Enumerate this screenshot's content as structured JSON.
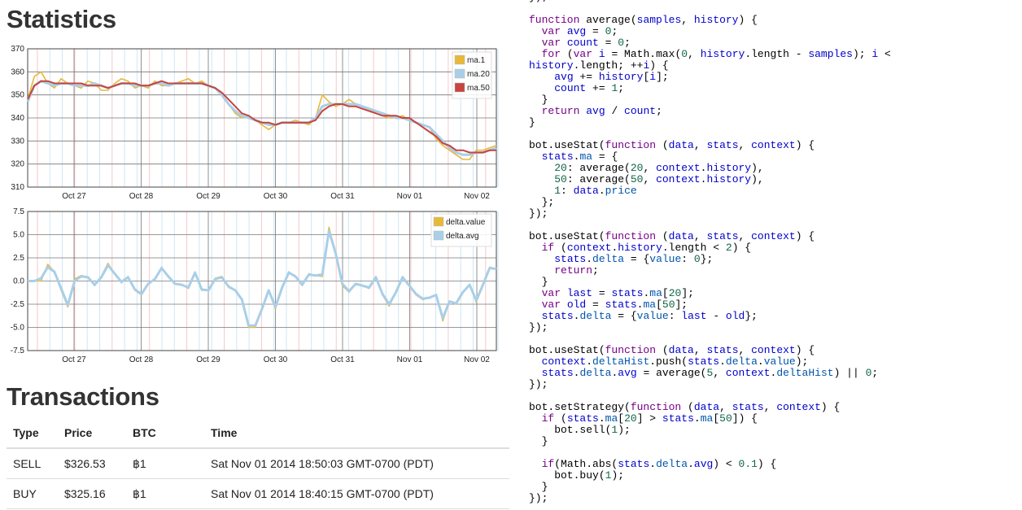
{
  "statistics_title": "Statistics",
  "transactions_title": "Transactions",
  "chart_data": [
    {
      "type": "line",
      "ylim": [
        310,
        370
      ],
      "yticks": [
        "370",
        "360",
        "350",
        "340",
        "330",
        "320",
        "310"
      ],
      "xticks": [
        "Oct 27",
        "Oct 28",
        "Oct 29",
        "Oct 30",
        "Oct 31",
        "Nov 01",
        "Nov 02"
      ],
      "legend": "top-right",
      "grid": true,
      "colors": {
        "ma.1": "#e8b83a",
        "ma.20": "#a9cfe8",
        "ma.50": "#c8443e"
      },
      "series": [
        {
          "name": "ma.1",
          "values": [
            348,
            358,
            360,
            355,
            353,
            357,
            355,
            354,
            353,
            356,
            355,
            352,
            352,
            355,
            357,
            356,
            353,
            354,
            353,
            356,
            354,
            354,
            355,
            356,
            357,
            355,
            356,
            354,
            353,
            350,
            346,
            342,
            340,
            341,
            339,
            337,
            335,
            337,
            338,
            338,
            339,
            338,
            337,
            340,
            350,
            347,
            345,
            346,
            348,
            346,
            345,
            344,
            342,
            341,
            340,
            340,
            341,
            339,
            338,
            337,
            336,
            331,
            328,
            326,
            324,
            322,
            322,
            326,
            326,
            327,
            328
          ]
        },
        {
          "name": "ma.20",
          "values": [
            347,
            354,
            356,
            355,
            354,
            355,
            355,
            354,
            354,
            354,
            355,
            354,
            353,
            354,
            355,
            355,
            354,
            354,
            354,
            355,
            355,
            354,
            355,
            355,
            355,
            355,
            355,
            354,
            353,
            350,
            346,
            343,
            341,
            340,
            339,
            338,
            337,
            337,
            338,
            338,
            338,
            338,
            338,
            340,
            345,
            346,
            346,
            346,
            346,
            346,
            345,
            344,
            343,
            342,
            341,
            340,
            340,
            339,
            338,
            337,
            336,
            333,
            330,
            327,
            325,
            324,
            324,
            325,
            325,
            326,
            327
          ]
        },
        {
          "name": "ma.50",
          "values": [
            348,
            354,
            356,
            356,
            355,
            355,
            355,
            355,
            355,
            354,
            354,
            354,
            353,
            354,
            355,
            355,
            355,
            354,
            354,
            355,
            356,
            355,
            355,
            355,
            355,
            355,
            355,
            354,
            353,
            351,
            348,
            345,
            342,
            341,
            339,
            338,
            338,
            337,
            338,
            338,
            338,
            338,
            338,
            339,
            343,
            345,
            346,
            346,
            345,
            345,
            344,
            343,
            342,
            341,
            341,
            341,
            340,
            340,
            338,
            336,
            334,
            332,
            329,
            328,
            326,
            326,
            325,
            325,
            325,
            326,
            326
          ]
        }
      ]
    },
    {
      "type": "line",
      "ylim": [
        -7.5,
        7.5
      ],
      "yticks": [
        "7.5",
        "5.0",
        "2.5",
        "0.0",
        "-2.5",
        "-5.0",
        "-7.5"
      ],
      "xticks": [
        "Oct 27",
        "Oct 28",
        "Oct 29",
        "Oct 30",
        "Oct 31",
        "Nov 01",
        "Nov 02"
      ],
      "legend": "top-right",
      "grid": true,
      "colors": {
        "delta.value": "#e8b83a",
        "delta.avg": "#a9cfe8"
      },
      "series": [
        {
          "name": "delta.value",
          "values": [
            0,
            0,
            0,
            1.8,
            1,
            -1,
            -2.8,
            0.2,
            0.6,
            0.4,
            -0.5,
            0.5,
            1.9,
            0.8,
            -0.2,
            0.5,
            -1,
            -1.5,
            -0.3,
            0.2,
            1.5,
            0.5,
            -0.3,
            -0.4,
            -0.8,
            1,
            -1,
            -1,
            0.3,
            0.5,
            -0.7,
            -1,
            -2,
            -5,
            -5,
            -3,
            -1,
            -3,
            -0.8,
            1,
            0.5,
            -0.5,
            0.8,
            0.6,
            0.5,
            5.8,
            3,
            -0.5,
            -1.2,
            -0.3,
            -0.5,
            -0.8,
            0.5,
            -1.5,
            -2.7,
            -1.2,
            0.5,
            -0.5,
            -1.5,
            -2,
            -1.8,
            -1.5,
            -4.3,
            -2.2,
            -2.5,
            -1.2,
            -0.4,
            -2.3,
            -0.5,
            1.5,
            1.3
          ]
        },
        {
          "name": "delta.avg",
          "values": [
            0,
            0,
            0.3,
            1.5,
            1,
            -0.8,
            -2.6,
            0,
            0.5,
            0.4,
            -0.4,
            0.4,
            1.7,
            0.8,
            -0.1,
            0.4,
            -0.9,
            -1.4,
            -0.3,
            0.2,
            1.4,
            0.5,
            -0.3,
            -0.4,
            -0.7,
            0.9,
            -0.9,
            -1,
            0.2,
            0.4,
            -0.6,
            -1,
            -2,
            -4.8,
            -4.8,
            -3,
            -1,
            -2.8,
            -0.7,
            0.9,
            0.5,
            -0.4,
            0.7,
            0.6,
            0.7,
            5.4,
            3,
            -0.3,
            -1.1,
            -0.3,
            -0.5,
            -0.7,
            0.4,
            -1.4,
            -2.5,
            -1.2,
            0.4,
            -0.5,
            -1.4,
            -1.9,
            -1.8,
            -1.5,
            -4,
            -2.2,
            -2.4,
            -1.2,
            -0.4,
            -2.1,
            -0.4,
            1.4,
            1.3
          ]
        }
      ]
    }
  ],
  "transactions": {
    "headers": [
      "Type",
      "Price",
      "BTC",
      "Time"
    ],
    "rows": [
      [
        "SELL",
        "$326.53",
        "฿1",
        "Sat Nov 01 2014 18:50:03 GMT-0700 (PDT)"
      ],
      [
        "BUY",
        "$325.16",
        "฿1",
        "Sat Nov 01 2014 18:40:15 GMT-0700 (PDT)"
      ]
    ]
  },
  "code_lines": [
    "});",
    "",
    "function average(samples, history) {",
    "  var avg = 0;",
    "  var count = 0;",
    "  for (var i = Math.max(0, history.length - samples); i <",
    "history.length; ++i) {",
    "    avg += history[i];",
    "    count += 1;",
    "  }",
    "  return avg / count;",
    "}",
    "",
    "bot.useStat(function (data, stats, context) {",
    "  stats.ma = {",
    "    20: average(20, context.history),",
    "    50: average(50, context.history),",
    "    1: data.price",
    "  };",
    "});",
    "",
    "bot.useStat(function (data, stats, context) {",
    "  if (context.history.length < 2) {",
    "    stats.delta = {value: 0};",
    "    return;",
    "  }",
    "  var last = stats.ma[20];",
    "  var old = stats.ma[50];",
    "  stats.delta = {value: last - old};",
    "});",
    "",
    "bot.useStat(function (data, stats, context) {",
    "  context.deltaHist.push(stats.delta.value);",
    "  stats.delta.avg = average(5, context.deltaHist) || 0;",
    "});",
    "",
    "bot.setStrategy(function (data, stats, context) {",
    "  if (stats.ma[20] > stats.ma[50]) {",
    "    bot.sell(1);",
    "  }",
    "",
    "  if(Math.abs(stats.delta.avg) < 0.1) {",
    "    bot.buy(1);",
    "  }",
    "});"
  ]
}
